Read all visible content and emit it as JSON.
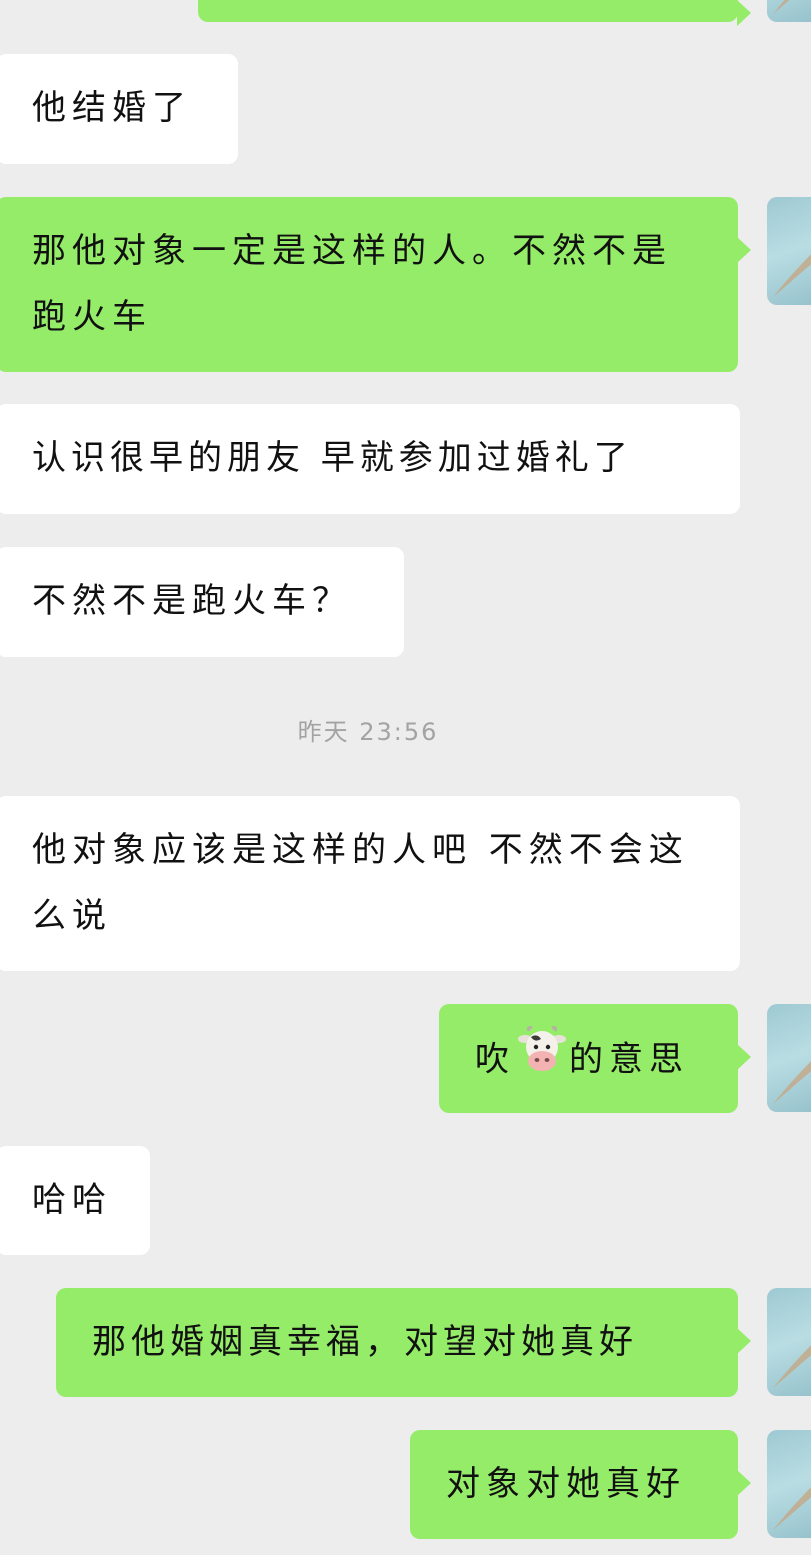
{
  "messages": [
    {
      "id": "m0",
      "side": "out",
      "text": ""
    },
    {
      "id": "m1",
      "side": "in",
      "text": "他结婚了"
    },
    {
      "id": "m2",
      "side": "out",
      "text": "那他对象一定是这样的人。不然不是跑火车"
    },
    {
      "id": "m3",
      "side": "in",
      "text": "认识很早的朋友  早就参加过婚礼了"
    },
    {
      "id": "m4",
      "side": "in",
      "text": "不然不是跑火车？"
    },
    {
      "id": "m5",
      "side": "in",
      "text": "他对象应该是这样的人吧  不然不会这么说"
    },
    {
      "id": "m6",
      "side": "out",
      "text_before": "吹",
      "emoji": "cow-face",
      "text_after": "的意思"
    },
    {
      "id": "m7",
      "side": "in",
      "text": "哈哈"
    },
    {
      "id": "m8",
      "side": "out",
      "text": "那他婚姻真幸福，对望对她真好"
    },
    {
      "id": "m9",
      "side": "out",
      "text": "对象对她真好"
    }
  ],
  "timestamp": "昨天 23:56",
  "colors": {
    "background": "#ededed",
    "incoming_bubble": "#ffffff",
    "outgoing_bubble": "#95ec69",
    "timestamp": "#a3a3a3"
  },
  "icons": {
    "avatar": "feather-avatar",
    "emoji": "cow-face-emoji"
  }
}
